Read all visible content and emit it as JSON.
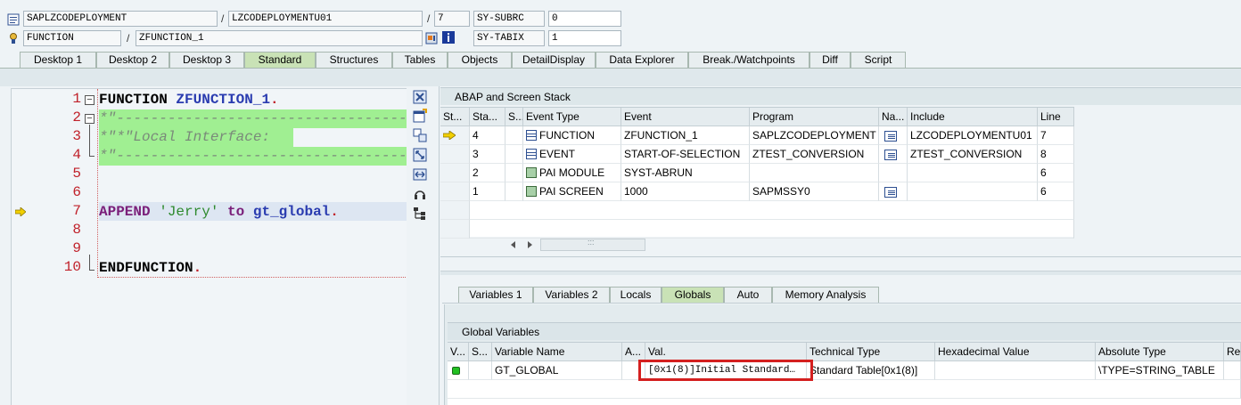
{
  "header": {
    "program": "SAPLZCODEPLOYMENT",
    "include": "LZCODEPLOYMENTU01",
    "line": "7",
    "subrc_label": "SY-SUBRC",
    "subrc_value": "0",
    "event_type": "FUNCTION",
    "event": "ZFUNCTION_1",
    "tabix_label": "SY-TABIX",
    "tabix_value": "1",
    "slash": "/"
  },
  "tabs": [
    "Desktop 1",
    "Desktop 2",
    "Desktop 3",
    "Standard",
    "Structures",
    "Tables",
    "Objects",
    "DetailDisplay",
    "Data Explorer",
    "Break./Watchpoints",
    "Diff",
    "Script"
  ],
  "editor": {
    "line_numbers": [
      "1",
      "2",
      "3",
      "4",
      "5",
      "6",
      "7",
      "8",
      "9",
      "10"
    ],
    "line1_kw": "FUNCTION",
    "line1_name": "ZFUNCTION_1",
    "dot": ".",
    "line2": "*\"----------------------------------",
    "line3": "*\"*\"Local Interface:",
    "line4": "*\"----------------------------------",
    "line7_kw": "APPEND",
    "line7_str": "'Jerry'",
    "line7_kw2": "to",
    "line7_var": "gt_global",
    "line10": "ENDFUNCTION"
  },
  "stack": {
    "title": "ABAP and Screen Stack",
    "columns": [
      "St...",
      "Sta...",
      "S...",
      "Event Type",
      "Event",
      "Program",
      "Na...",
      "Include",
      "Line"
    ],
    "rows": [
      {
        "level": "4",
        "event_type": "FUNCTION",
        "event": "ZFUNCTION_1",
        "program": "SAPLZCODEPLOYMENT",
        "include": "LZCODEPLOYMENTU01",
        "line": "7"
      },
      {
        "level": "3",
        "event_type": "EVENT",
        "event": "START-OF-SELECTION",
        "program": "ZTEST_CONVERSION",
        "include": "ZTEST_CONVERSION",
        "line": "8"
      },
      {
        "level": "2",
        "event_type": "PAI MODULE",
        "event": "SYST-ABRUN",
        "program": "",
        "include": "",
        "line": "6"
      },
      {
        "level": "1",
        "event_type": "PAI SCREEN",
        "event": "1000",
        "program": "SAPMSSY0",
        "include": "",
        "line": "6"
      }
    ],
    "scroll_grip": ":::"
  },
  "var_tabs": [
    "Variables 1",
    "Variables 2",
    "Locals",
    "Globals",
    "Auto",
    "Memory Analysis"
  ],
  "globals": {
    "title": "Global Variables",
    "columns": [
      "V...",
      "S...",
      "Variable Name",
      "A...",
      "Val.",
      "Technical Type",
      "Hexadecimal Value",
      "Absolute Type",
      "Re"
    ],
    "row": {
      "name": "GT_GLOBAL",
      "value": "[0x1(8)]Initial Standard…",
      "tech_type": "Standard Table[0x1(8)]",
      "hex": "",
      "abs_type": "\\TYPE=STRING_TABLE"
    }
  },
  "colors": {
    "active_tab": "#c9e2b6",
    "comment_bg": "#a0ef92",
    "current_line_bg": "#dde6f2",
    "highlight_box": "#d41f1f"
  }
}
